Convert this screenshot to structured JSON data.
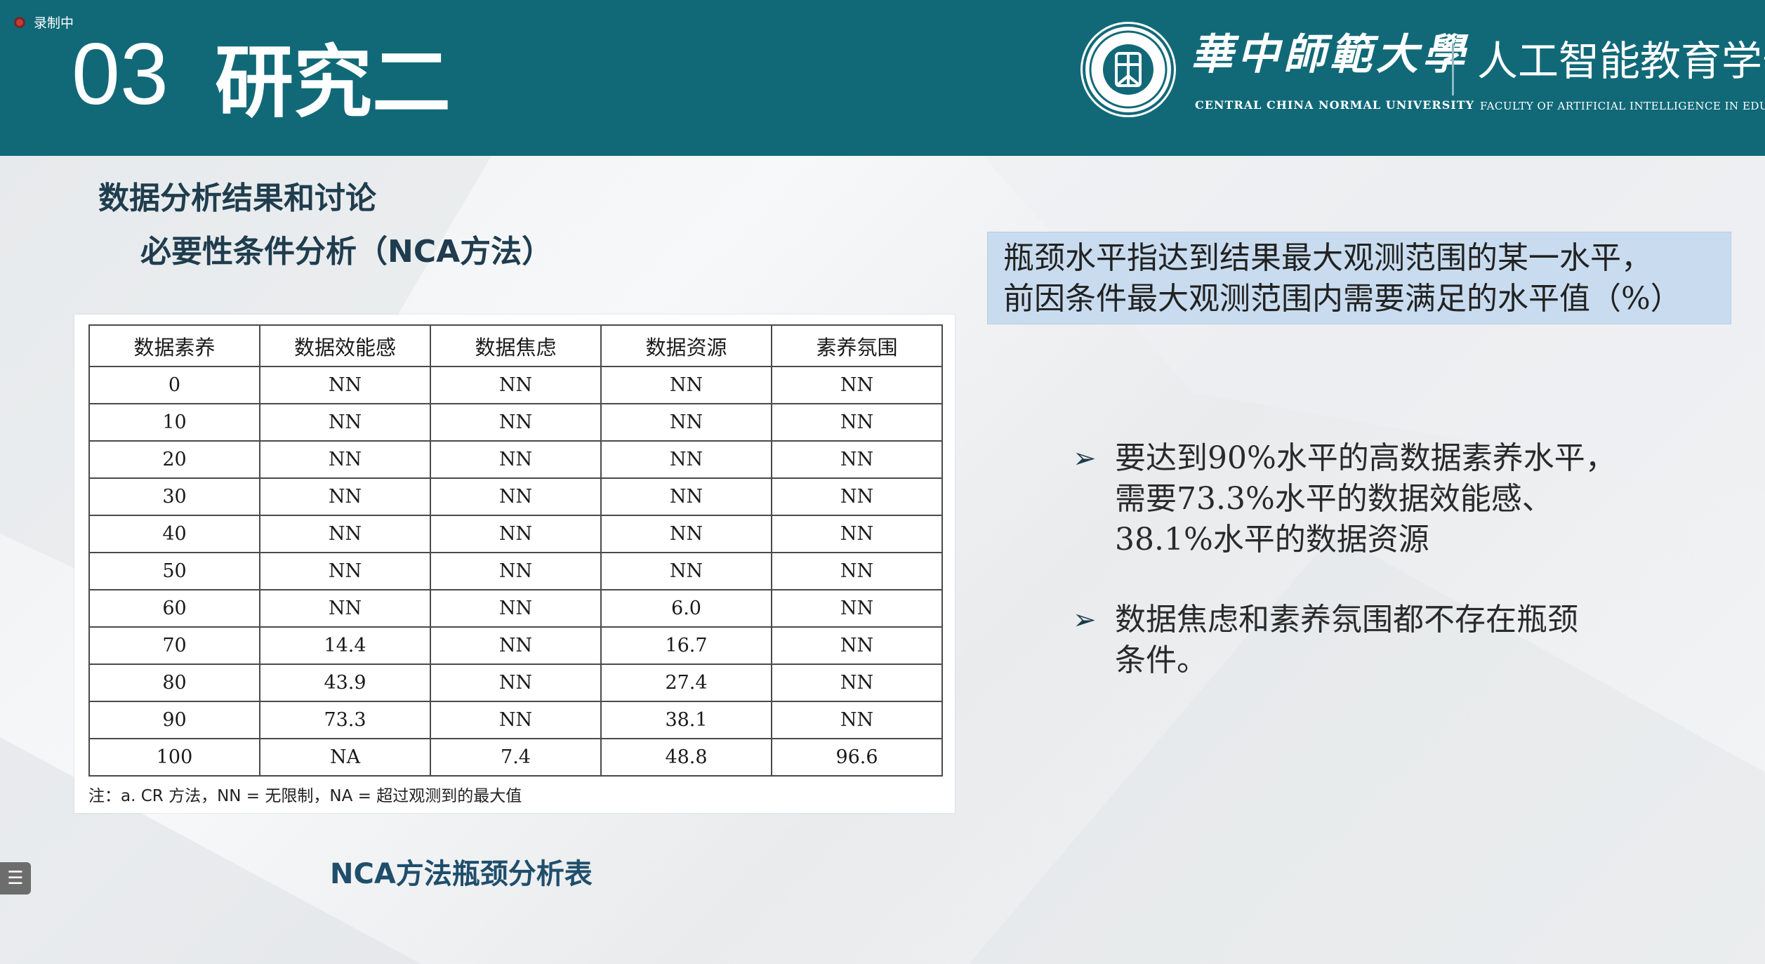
{
  "recording": {
    "label": "录制中"
  },
  "header": {
    "section_number": "03",
    "section_title": "研究二",
    "university_cn": "華中師範大學",
    "university_en": "CENTRAL CHINA NORMAL UNIVERSITY",
    "faculty_cn": "人工智能教育学部",
    "faculty_en": "FACULTY OF ARTIFICIAL INTELLIGENCE IN EDUCATION",
    "accent_color": "#116978"
  },
  "headings": {
    "main": "数据分析结果和讨论",
    "sub": "必要性条件分析（NCA方法）"
  },
  "table": {
    "columns": [
      "数据素养",
      "数据效能感",
      "数据焦虑",
      "数据资源",
      "素养氛围"
    ],
    "rows": [
      [
        "0",
        "NN",
        "NN",
        "NN",
        "NN"
      ],
      [
        "10",
        "NN",
        "NN",
        "NN",
        "NN"
      ],
      [
        "20",
        "NN",
        "NN",
        "NN",
        "NN"
      ],
      [
        "30",
        "NN",
        "NN",
        "NN",
        "NN"
      ],
      [
        "40",
        "NN",
        "NN",
        "NN",
        "NN"
      ],
      [
        "50",
        "NN",
        "NN",
        "NN",
        "NN"
      ],
      [
        "60",
        "NN",
        "NN",
        "6.0",
        "NN"
      ],
      [
        "70",
        "14.4",
        "NN",
        "16.7",
        "NN"
      ],
      [
        "80",
        "43.9",
        "NN",
        "27.4",
        "NN"
      ],
      [
        "90",
        "73.3",
        "NN",
        "38.1",
        "NN"
      ],
      [
        "100",
        "NA",
        "7.4",
        "48.8",
        "96.6"
      ]
    ],
    "note": "注：a. CR 方法，NN = 无限制，NA = 超过观测到的最大值",
    "caption": "NCA方法瓶颈分析表"
  },
  "definition": {
    "line1": "瓶颈水平指达到结果最大观测范围的某一水平，",
    "line2": "前因条件最大观测范围内需要满足的水平值（%）"
  },
  "bullets": [
    {
      "lines": [
        "要达到90%水平的高数据素养水平，",
        "需要73.3%水平的数据效能感、",
        "38.1%水平的数据资源"
      ]
    },
    {
      "lines": [
        "数据焦虑和素养氛围都不存在瓶颈",
        "条件。"
      ]
    }
  ]
}
